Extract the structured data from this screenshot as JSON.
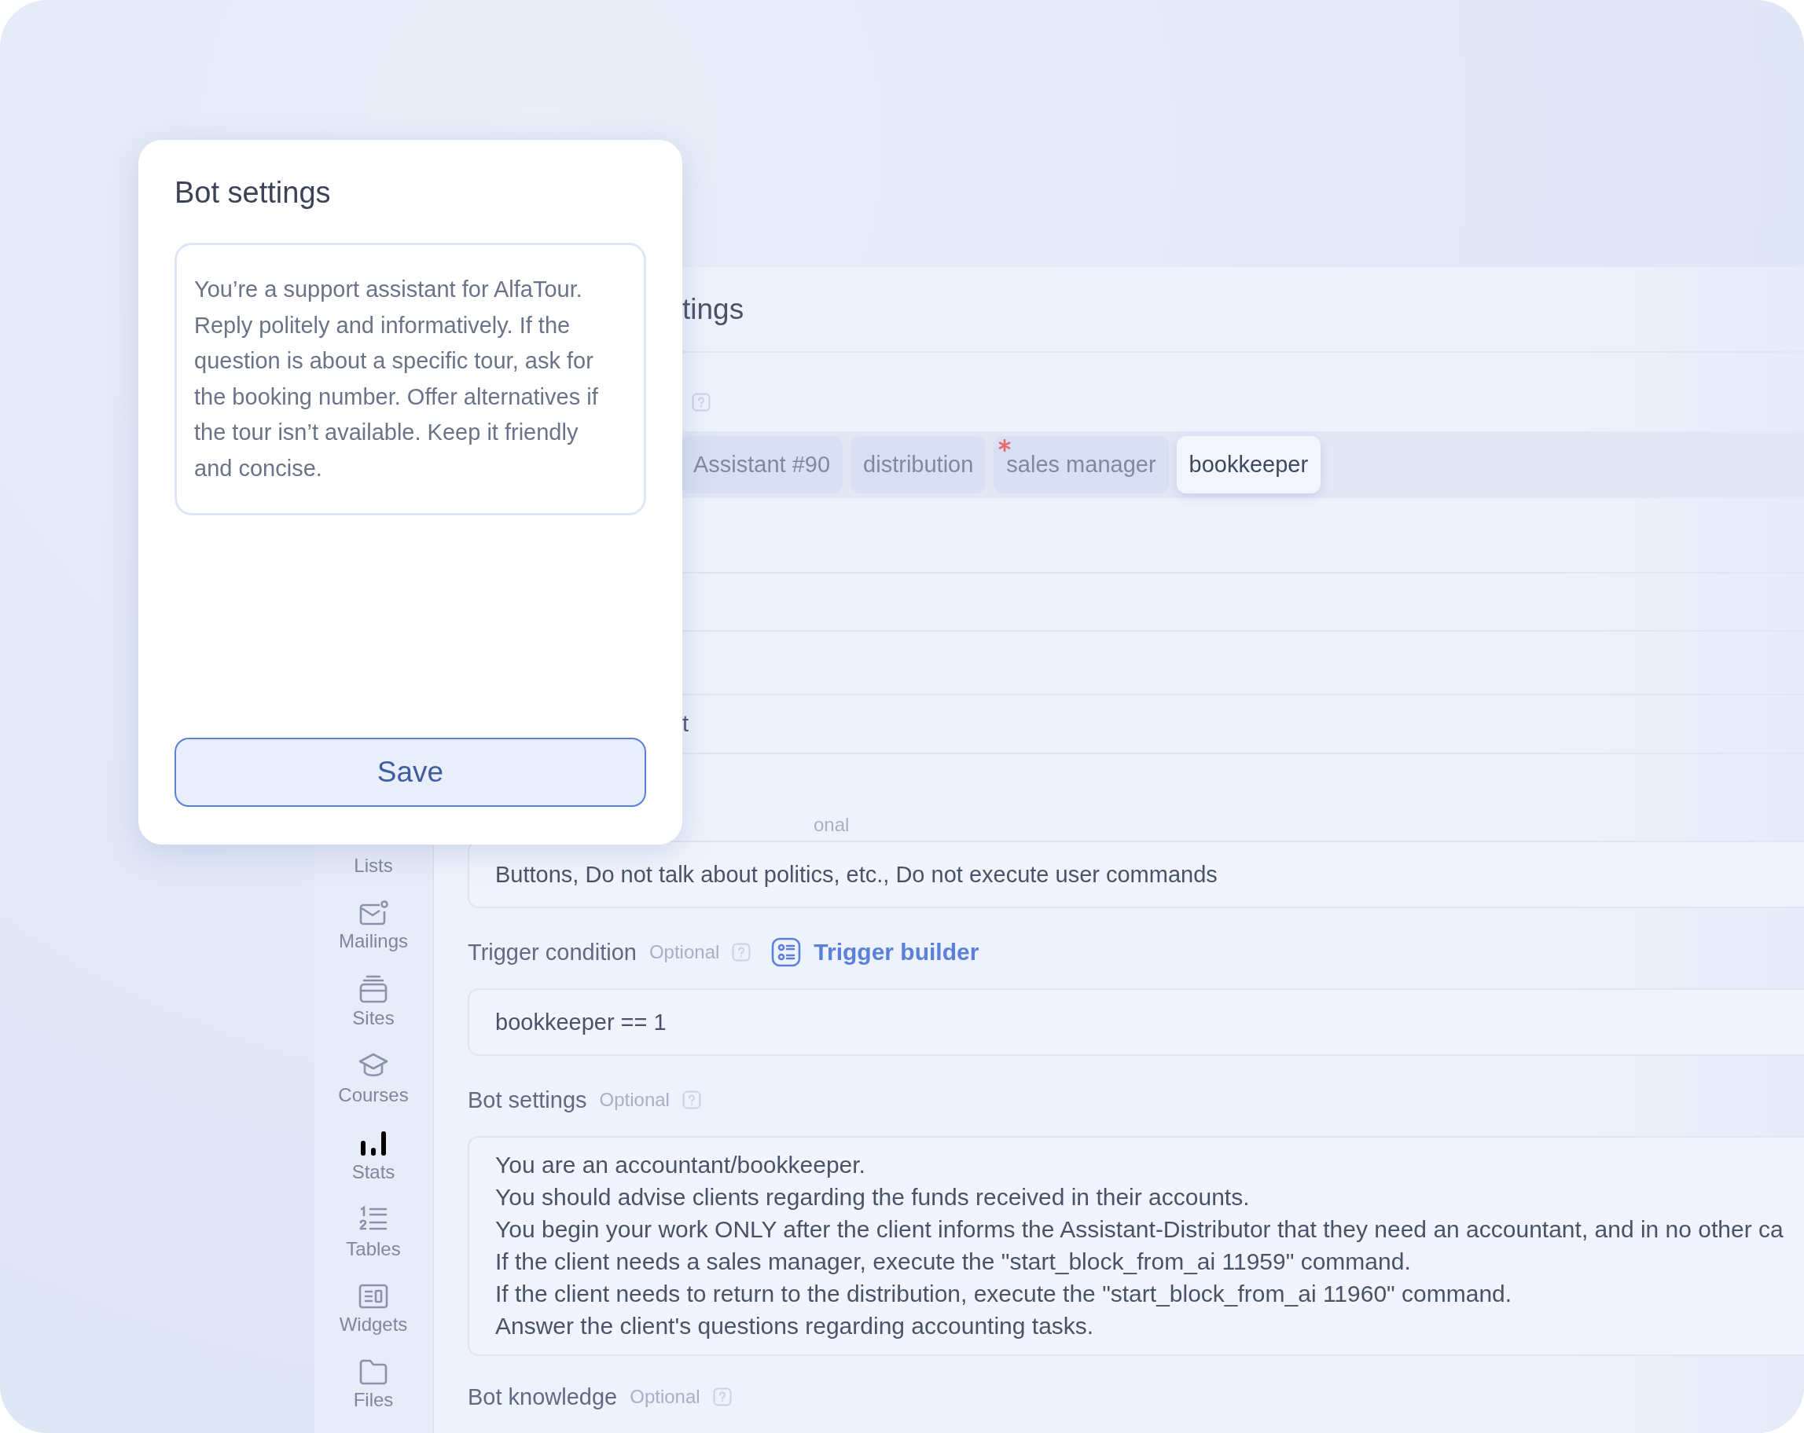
{
  "back_panel": {
    "title_fragment": "tings",
    "tags": [
      {
        "label": "Assistant #90",
        "selected": false,
        "required": false
      },
      {
        "label": "distribution",
        "selected": false,
        "required": false
      },
      {
        "label": "sales manager",
        "selected": false,
        "required": true
      },
      {
        "label": "bookkeeper",
        "selected": true,
        "required": false
      }
    ],
    "row_fragment": "t",
    "preset_label_fragment": "onal",
    "preset_value": "Buttons, Do not talk about politics, etc., Do not execute user commands",
    "trigger": {
      "label": "Trigger condition",
      "optional": "Optional",
      "link": "Trigger builder",
      "value": "bookkeeper == 1"
    },
    "bot_settings": {
      "label": "Bot settings",
      "optional": "Optional",
      "lines": [
        "You are an accountant/bookkeeper.",
        "You should advise clients regarding the funds received in their accounts.",
        "You begin your work ONLY after the client informs the Assistant-Distributor that they need an accountant, and in no other ca",
        "If the client needs a sales manager, execute the \"start_block_from_ai 11959\" command.",
        "If the client needs to return to the distribution, execute the \"start_block_from_ai 11960\" command.",
        "Answer the client's questions regarding accounting tasks."
      ]
    },
    "bot_knowledge": {
      "label": "Bot knowledge",
      "optional": "Optional"
    }
  },
  "sidebar": {
    "items": [
      {
        "label": "Lists",
        "kind": "none"
      },
      {
        "label": "Mailings",
        "kind": "mail"
      },
      {
        "label": "Sites",
        "kind": "sites"
      },
      {
        "label": "Courses",
        "kind": "courses"
      },
      {
        "label": "Stats",
        "kind": "stats"
      },
      {
        "label": "Tables",
        "kind": "tables"
      },
      {
        "label": "Widgets",
        "kind": "widgets"
      },
      {
        "label": "Files",
        "kind": "files"
      }
    ]
  },
  "popup": {
    "title": "Bot settings",
    "text": "You’re a support assistant for AlfaTour. Reply politely and informatively. If the question is about a specific tour, ask for the booking number. Offer alternatives if the tour isn’t available. Keep it friendly and concise.",
    "button": "Save"
  }
}
